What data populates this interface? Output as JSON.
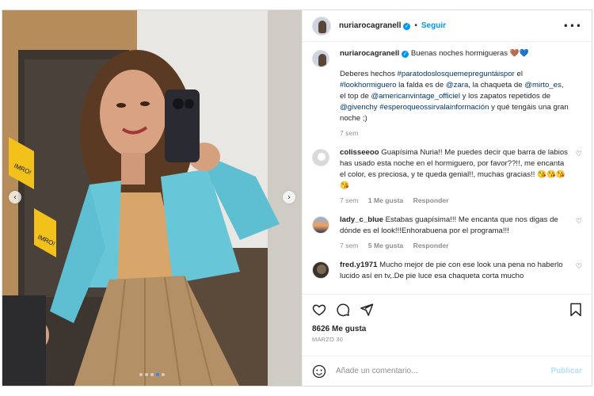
{
  "header": {
    "username": "nuriarocagranell",
    "follow_label": "Seguir",
    "separator": "•",
    "more_label": "•••"
  },
  "caption": {
    "username": "nuriarocagranell",
    "line1": "Buenas noches hormigueras 🤎💙",
    "body_parts": [
      {
        "text": "Deberes hechos ",
        "tag": false
      },
      {
        "text": "#paratodoslosquemepreguntáispor",
        "tag": true
      },
      {
        "text": " el ",
        "tag": false
      },
      {
        "text": "#lookhormiguero",
        "tag": true
      },
      {
        "text": " la falda es de ",
        "tag": false
      },
      {
        "text": "@zara",
        "tag": true
      },
      {
        "text": ", la chaqueta de ",
        "tag": false
      },
      {
        "text": "@mirto_es",
        "tag": true
      },
      {
        "text": ", el top de ",
        "tag": false
      },
      {
        "text": "@americanvintage_officiel",
        "tag": true
      },
      {
        "text": " y los zapatos repetidos de ",
        "tag": false
      },
      {
        "text": "@givenchy",
        "tag": true
      },
      {
        "text": " ",
        "tag": false
      },
      {
        "text": "#esperoqueossirvalainformación",
        "tag": true
      },
      {
        "text": " y qué tengáis una gran noche ;)",
        "tag": false
      }
    ],
    "time": "7 sem"
  },
  "comments": [
    {
      "username": "colisseeoo",
      "text": "Guapísima Nuria!! Me puedes decir que barra de labios has usado esta noche en el hormiguero, por favor??!!, me encanta el color, es preciosa, y te queda genial!!, muchas gracias!! 😘😘😘😘",
      "time": "7 sem",
      "likes": "1 Me gusta",
      "reply": "Responder"
    },
    {
      "username": "lady_c_blue",
      "text": "Estabas guapísima!!! Me encanta que nos digas de dónde es el look!!!Enhorabuena por el programa!!!",
      "time": "7 sem",
      "likes": "5 Me gusta",
      "reply": "Responder"
    },
    {
      "username": "fred.y1971",
      "text": "Mucho mejor de pie con ese look una pena no haberlo lucido así en tv,.De pie luce esa chaqueta corta mucho",
      "time": "",
      "likes": "",
      "reply": ""
    }
  ],
  "stats": {
    "likes": "8626 Me gusta",
    "date": "MARZO 30"
  },
  "add_comment": {
    "placeholder": "Añade un comentario...",
    "post_label": "Publicar"
  },
  "carousel": {
    "prev": "‹",
    "next": "›",
    "dot_count": 5,
    "active_index": 3
  },
  "icons": {
    "like": "heart-icon",
    "comment": "comment-icon",
    "share": "send-icon",
    "save": "bookmark-icon",
    "emoji": "emoji-icon"
  },
  "colors": {
    "accent": "#0095f6",
    "tag": "#00376b",
    "muted": "#8e8e8e",
    "publish_disabled": "#b2dffc"
  }
}
